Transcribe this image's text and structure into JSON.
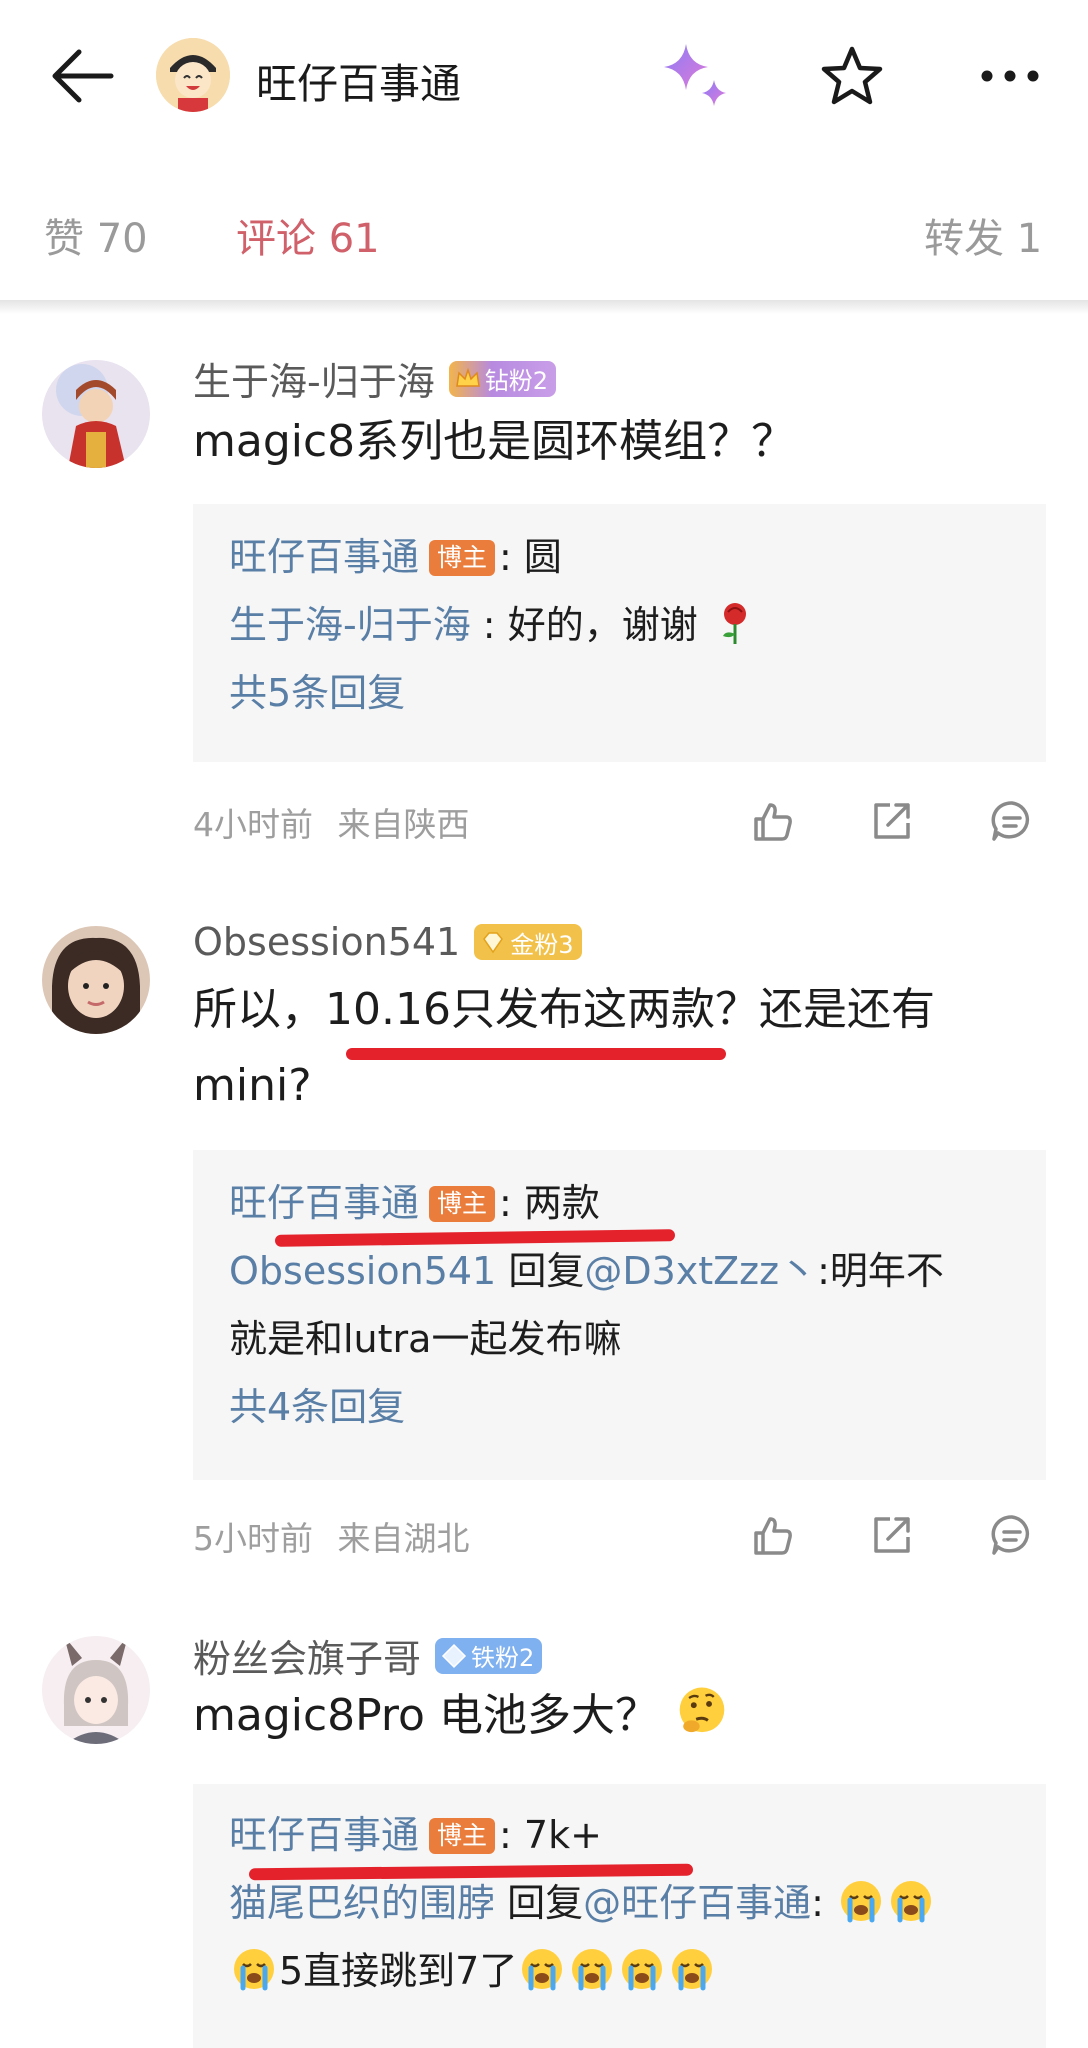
{
  "header": {
    "title": "旺仔百事通"
  },
  "tabs": [
    {
      "label": "赞 70"
    },
    {
      "label": "评论 61"
    },
    {
      "label": "转发 1"
    }
  ],
  "colors": {
    "accent": "#d0606a",
    "link": "#5a7fa6",
    "boss_badge": "#ea7d3c",
    "diamond_badge": "#b78ae0",
    "gold_badge": "#f2c14a",
    "iron_badge": "#7fb0f0",
    "annotation_red": "#e3222c"
  },
  "comments": [
    {
      "user": "生于海-归于海",
      "badge": "钻粉2",
      "text": "magic8系列也是圆环模组？？",
      "replies": [
        {
          "name": "旺仔百事通",
          "tag": "博主",
          "sep": ":",
          "text": " 圆"
        },
        {
          "name": "生于海-归于海",
          "sep": " :",
          "text": " 好的，谢谢"
        }
      ],
      "more": "共5条回复",
      "time": "4小时前",
      "location": "来自陕西"
    },
    {
      "user": "Obsession541",
      "badge": "金粉3",
      "text_a": "所以，",
      "text_b": "10.16只发布这两款",
      "text_c": "？还是还有mini?",
      "replies": [
        {
          "name": "旺仔百事通",
          "tag": "博主",
          "sep": ":",
          "text": " 两款"
        },
        {
          "name": "Obsession541",
          "text": " 回复",
          "mention": "@D3xtZzz丶",
          "text2": ":明年不",
          "text3": "就是和lutra一起发布嘛"
        }
      ],
      "more": "共4条回复",
      "time": "5小时前",
      "location": "来自湖北"
    },
    {
      "user": "粉丝会旗子哥",
      "badge": "铁粉2",
      "text": "magic8Pro 电池多大？",
      "replies": [
        {
          "name": "旺仔百事通",
          "tag": "博主",
          "sep": ":",
          "text": " 7k+"
        },
        {
          "name": "猫尾巴织的围脖",
          "text": " 回复",
          "mention": "@旺仔百事通",
          "text2": ":"
        },
        {
          "text": "5直接跳到7了"
        }
      ]
    }
  ]
}
